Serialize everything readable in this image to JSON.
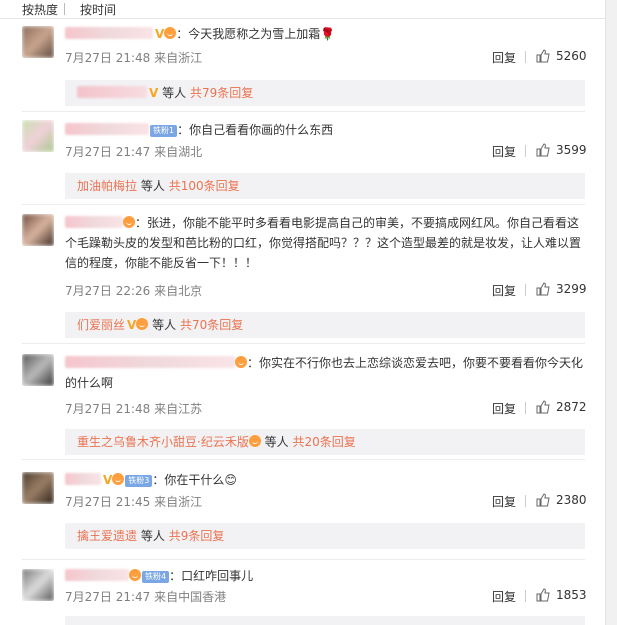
{
  "sort": {
    "hot": "按热度",
    "time": "按时间"
  },
  "comments": [
    {
      "text": "：今天我愿称之为雪上加霜🌹",
      "time": "7月27日 21:48",
      "location": "来自浙江",
      "reply": "回复",
      "likes": "5260",
      "sub": {
        "who": "",
        "suffix": "等人",
        "total": "共79条回复"
      }
    },
    {
      "text": "：你自己看看你画的什么东西",
      "fan": "铁粉1",
      "time": "7月27日 21:47",
      "location": "来自湖北",
      "reply": "回复",
      "likes": "3599",
      "sub": {
        "who": "加油帕梅拉",
        "suffix": "等人",
        "total": "共100条回复"
      }
    },
    {
      "text": "：张进，你能不能平时多看看电影提高自己的审美，不要搞成网红风。你自己看看这个毛躁勒头皮的发型和芭比粉的口红，你觉得搭配吗？？？这个造型最差的就是妆发，让人难以置信的程度，你能不能反省一下！！！",
      "time": "7月27日 22:26",
      "location": "来自北京",
      "reply": "回复",
      "likes": "3299",
      "sub": {
        "who": "们爱丽丝",
        "suffix": "等人",
        "total": "共70条回复"
      }
    },
    {
      "text": "：你实在不行你也去上恋综谈恋爱去吧，你要不要看看你今天化的什么啊",
      "time": "7月27日 21:48",
      "location": "来自江苏",
      "reply": "回复",
      "likes": "2872",
      "sub": {
        "who": "重生之乌鲁木齐小甜豆·纪云禾版",
        "suffix": "等人",
        "total": "共20条回复"
      }
    },
    {
      "text": "：你在干什么😊",
      "fan": "铁粉3",
      "time": "7月27日 21:45",
      "location": "来自浙江",
      "reply": "回复",
      "likes": "2380",
      "sub": {
        "who": "擒王爱遗遗",
        "suffix": "等人",
        "total": "共9条回复"
      }
    },
    {
      "text": "：口红咋回事儿",
      "fan": "铁粉4",
      "time": "7月27日 21:47",
      "location": "来自中国香港",
      "reply": "回复",
      "likes": "1853"
    }
  ],
  "colors": {
    "accent": "#eb7350",
    "meta": "#808080",
    "subbg": "#f2f2f5"
  }
}
